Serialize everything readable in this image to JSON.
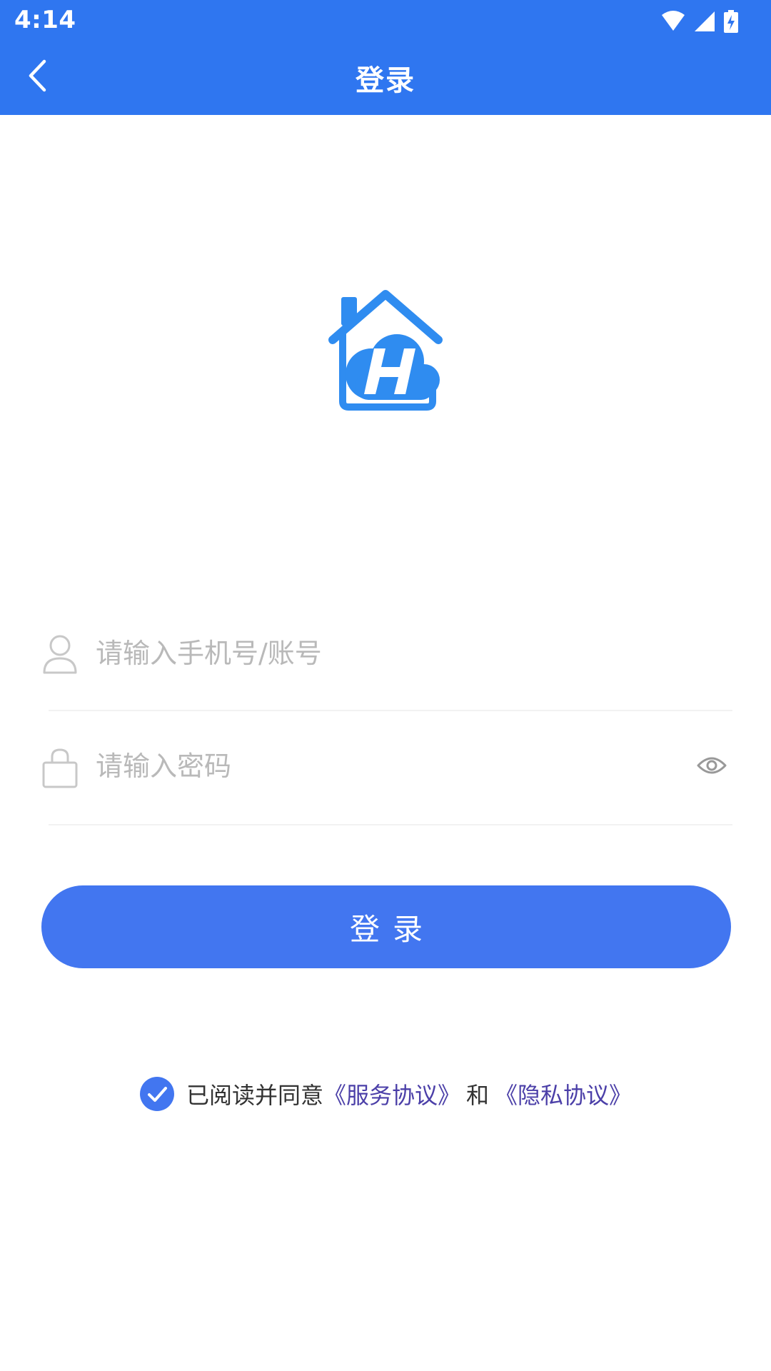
{
  "status_bar": {
    "time": "4:14",
    "icons": [
      "wifi-icon",
      "cell-signal-icon",
      "battery-charging-icon"
    ]
  },
  "app_bar": {
    "back_icon": "chevron-left-icon",
    "title": "登录"
  },
  "logo": {
    "icon": "house-cloud-h-logo"
  },
  "form": {
    "username": {
      "icon": "user-icon",
      "value": "",
      "placeholder": "请输入手机号/账号"
    },
    "password": {
      "icon": "lock-icon",
      "value": "",
      "placeholder": "请输入密码",
      "toggle_icon": "eye-icon"
    },
    "submit_label": "登录"
  },
  "agreement": {
    "checked": true,
    "prefix": "已阅读并同意",
    "service_link": "《服务协议》",
    "conjunction": "和",
    "privacy_link": "《隐私协议》"
  },
  "colors": {
    "accent": "#2F76F0",
    "button": "#4276F0",
    "link": "#4B3FA8",
    "placeholder": "#B9B9B9"
  }
}
